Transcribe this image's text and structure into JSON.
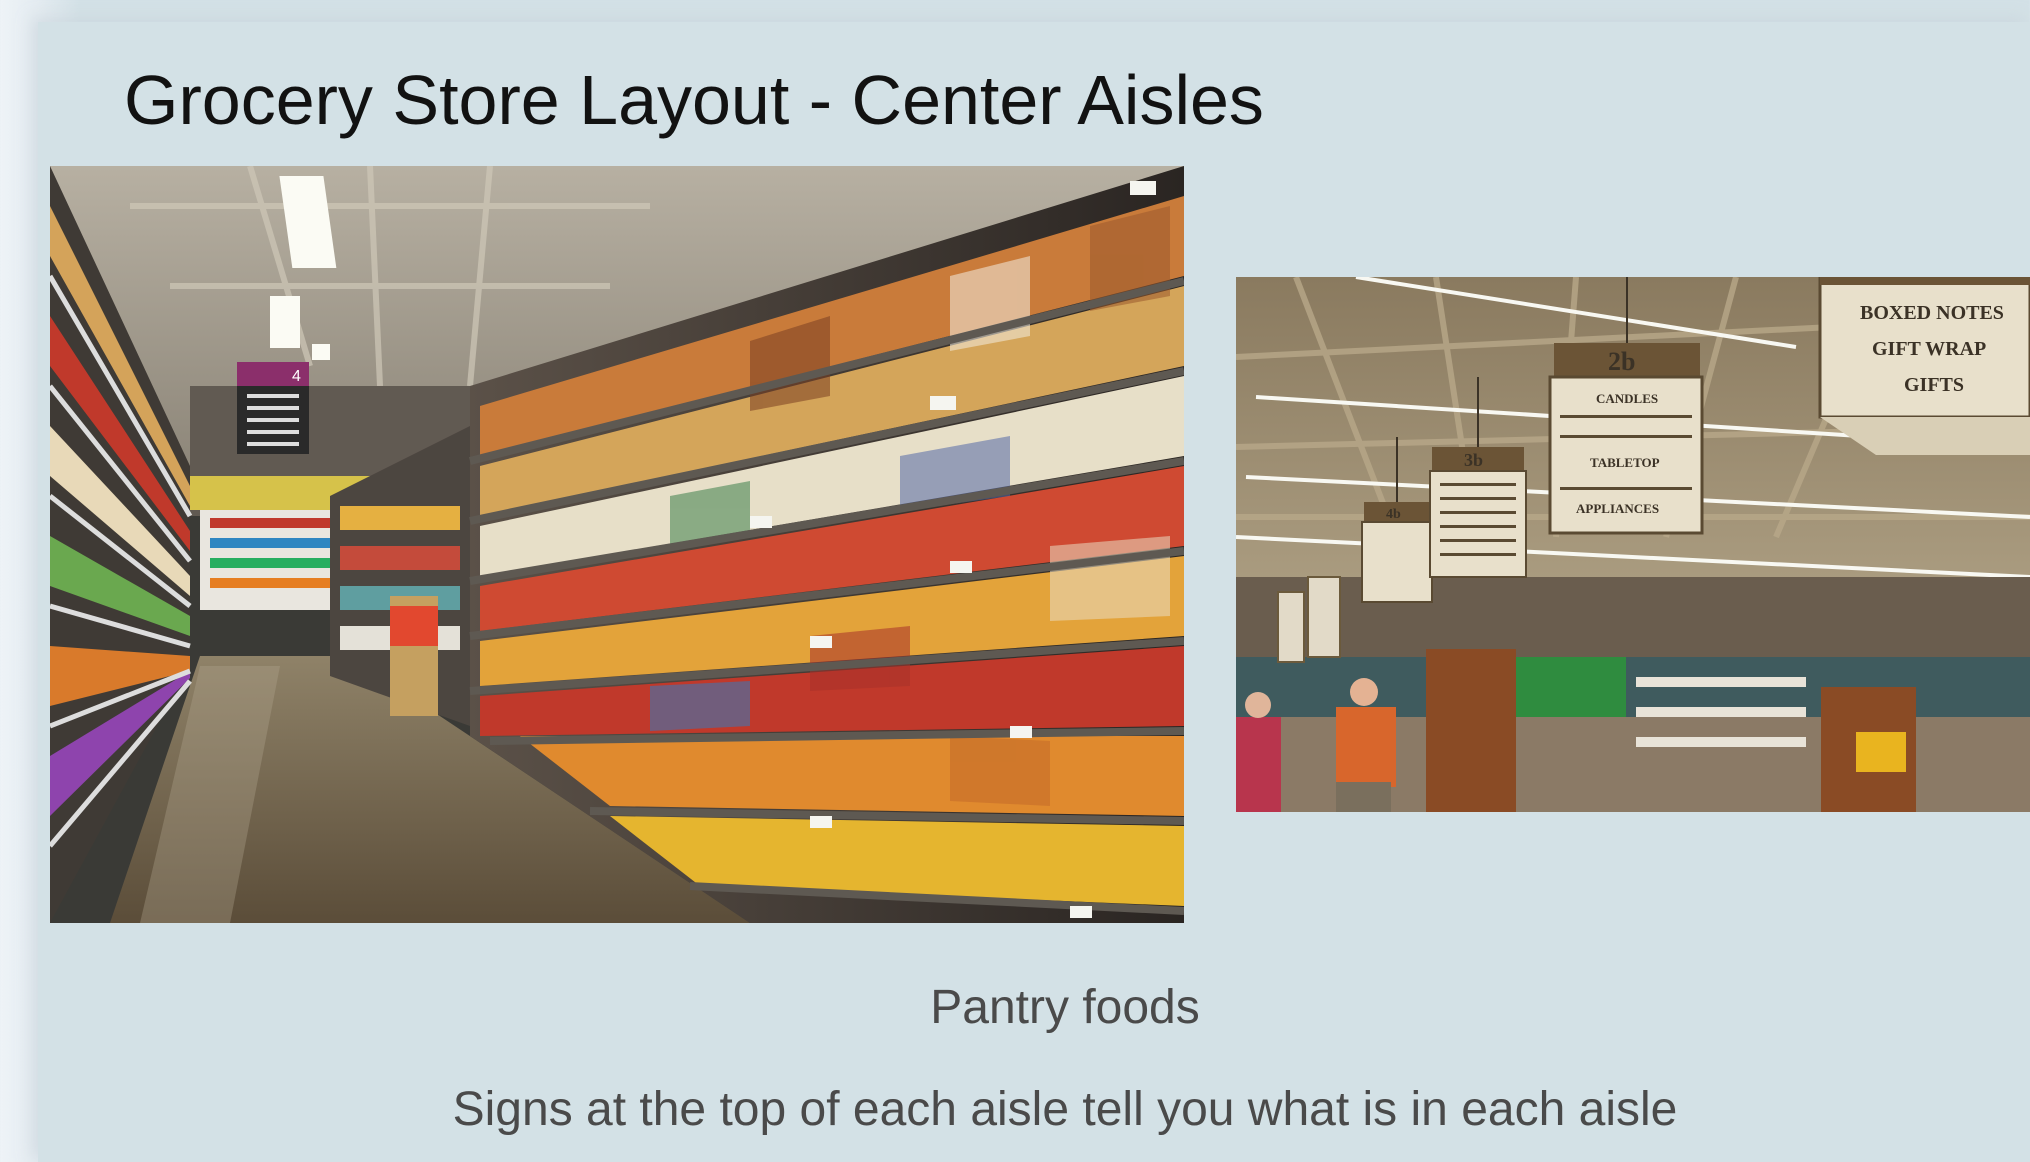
{
  "slide": {
    "title": "Grocery Store Layout - Center Aisles",
    "caption_primary": "Pantry foods",
    "caption_secondary": "Signs at the top of each aisle tell you what is in each aisle"
  },
  "signs_photo": {
    "big_sign_lines": [
      "BOXED NOTES",
      "GIFT WRAP",
      "GIFTS"
    ],
    "aisle_2b": {
      "number": "2b",
      "lines": [
        "CANDLES",
        "TABLETOP",
        "APPLIANCES"
      ]
    },
    "aisle_3b": {
      "number": "3b"
    },
    "aisle_4b": {
      "number": "4b"
    }
  },
  "aisle_photo": {
    "hanging_sign_number": "4"
  },
  "colors": {
    "background": "#d3e1e6",
    "title": "#121212",
    "caption": "#4a4a4a"
  }
}
